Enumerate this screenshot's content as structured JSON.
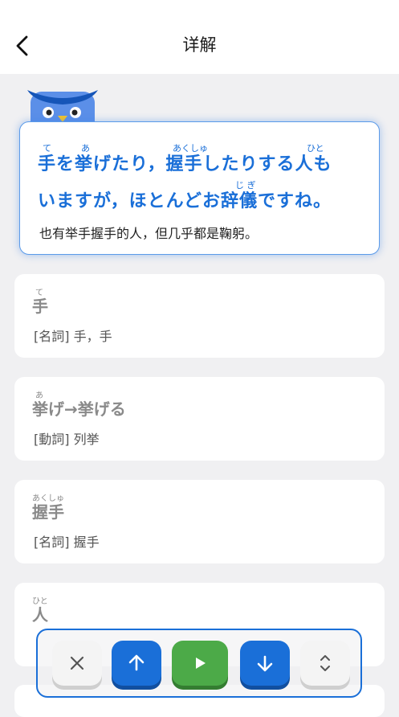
{
  "header": {
    "title": "详解"
  },
  "sentence": {
    "line1": "手を挙げたり，握手したりする人も",
    "line2": "いますが，ほとんどお辞儀ですね。",
    "ruby_te": "て",
    "ruby_a": "あ",
    "ruby_akushu": "あくしゅ",
    "ruby_hito": "ひと",
    "ruby_jigi": "じ ぎ",
    "translation": "也有举手握手的人，但几乎都是鞠躬。"
  },
  "words": [
    {
      "ruby": "て",
      "word": "手",
      "definition": "[名詞] 手，手"
    },
    {
      "ruby": "あ",
      "word": "挙げ→挙げる",
      "definition": "[動詞] 列挙"
    },
    {
      "ruby": "あくしゅ",
      "word": "握手",
      "definition": "[名詞] 握手"
    },
    {
      "ruby": "ひと",
      "word": "人",
      "definition": ""
    }
  ],
  "controls": {
    "close": "close-icon",
    "prev": "arrow-up-icon",
    "play": "play-icon",
    "next": "arrow-down-icon",
    "expand": "expand-icon"
  },
  "colors": {
    "accent": "#1a6fd8",
    "play": "#4caa48"
  }
}
